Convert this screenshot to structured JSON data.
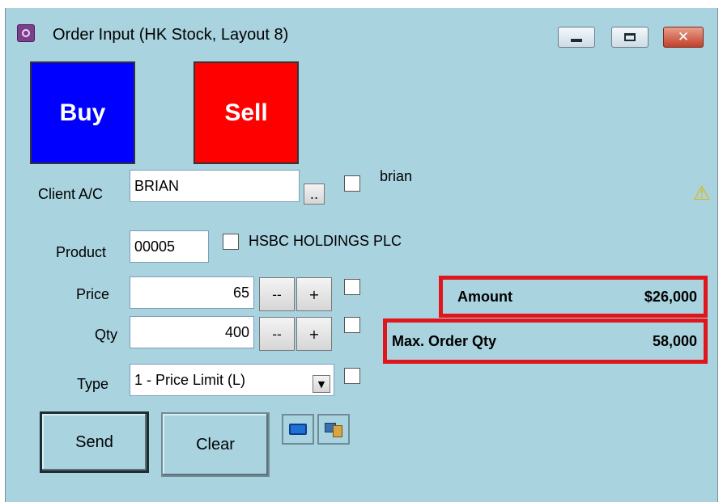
{
  "window": {
    "title": "Order Input (HK Stock, Layout 8)"
  },
  "buttons": {
    "buy": "Buy",
    "sell": "Sell",
    "send": "Send",
    "clear": "Clear",
    "browse": "..",
    "price_minus": "--",
    "price_plus": "+",
    "qty_minus": "--",
    "qty_plus": "+"
  },
  "client": {
    "label": "Client A/C",
    "value": "BRIAN",
    "name": "brian"
  },
  "product": {
    "label": "Product",
    "value": "00005",
    "name": "HSBC HOLDINGS PLC"
  },
  "price": {
    "label": "Price",
    "value": "65"
  },
  "qty": {
    "label": "Qty",
    "value": "400"
  },
  "type": {
    "label": "Type",
    "selected": "1 - Price Limit (L)"
  },
  "summary": {
    "amount_label": "Amount",
    "amount_value": "$26,000",
    "max_qty_label": "Max. Order Qty",
    "max_qty_value": "58,000"
  },
  "colors": {
    "window_bg": "#a9d3df",
    "buy": "#0000ff",
    "sell": "#ff0000",
    "highlight": "#e0161d"
  },
  "icons": [
    "app-icon",
    "warning-icon",
    "keyboard-icon",
    "computer-icon",
    "minimize-icon",
    "maximize-icon",
    "close-icon"
  ]
}
